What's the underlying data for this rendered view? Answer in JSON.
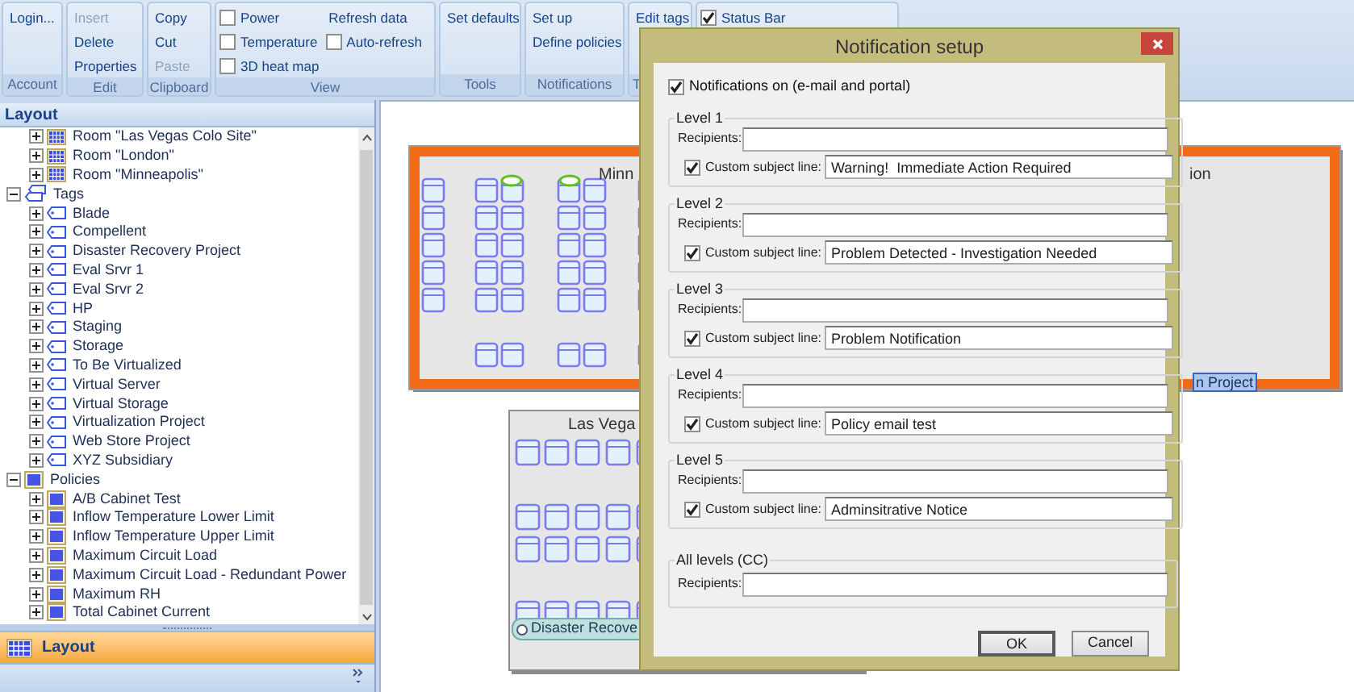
{
  "ribbon": {
    "groups": [
      {
        "label": "Account",
        "columns": [
          [
            {
              "kind": "button",
              "label": "Login...",
              "disabled": false
            }
          ]
        ]
      },
      {
        "label": "Edit",
        "columns": [
          [
            {
              "kind": "button",
              "label": "Insert",
              "disabled": true
            },
            {
              "kind": "button",
              "label": "Delete",
              "disabled": false
            },
            {
              "kind": "button",
              "label": "Properties",
              "disabled": false
            }
          ]
        ]
      },
      {
        "label": "Clipboard",
        "columns": [
          [
            {
              "kind": "button",
              "label": "Copy",
              "disabled": false
            },
            {
              "kind": "button",
              "label": "Cut",
              "disabled": false
            },
            {
              "kind": "button",
              "label": "Paste",
              "disabled": true
            }
          ]
        ]
      },
      {
        "label": "View",
        "columns": [
          [
            {
              "kind": "checkbox",
              "label": "Power",
              "checked": false
            },
            {
              "kind": "checkbox",
              "label": "Temperature",
              "checked": false
            },
            {
              "kind": "checkbox",
              "label": "3D heat map",
              "checked": false
            }
          ],
          [
            {
              "kind": "button",
              "label": "Refresh data",
              "disabled": false
            },
            {
              "kind": "checkbox",
              "label": "Auto-refresh",
              "checked": false
            }
          ]
        ]
      },
      {
        "label": "Tools",
        "columns": [
          [
            {
              "kind": "button",
              "label": "Set defaults",
              "disabled": false
            }
          ]
        ]
      },
      {
        "label": "Notifications",
        "columns": [
          [
            {
              "kind": "button",
              "label": "Set up",
              "disabled": false
            },
            {
              "kind": "button",
              "label": "Define policies",
              "disabled": false
            }
          ]
        ]
      },
      {
        "label": "T",
        "columns": [
          [
            {
              "kind": "button",
              "label": "Edit tags",
              "disabled": false
            }
          ]
        ]
      },
      {
        "columns": [
          [
            {
              "kind": "checkbox",
              "label": "Status Bar",
              "checked": true
            }
          ]
        ]
      }
    ]
  },
  "sidebar": {
    "title": "Layout",
    "tree": {
      "scrolled_children": [
        {
          "kind": "room",
          "label": "Room \"Las Vegas Colo Site\"",
          "expanded": false
        },
        {
          "kind": "room",
          "label": "Room \"London\"",
          "expanded": false
        },
        {
          "kind": "room",
          "label": "Room \"Minneapolis\"",
          "expanded": false
        }
      ],
      "items": [
        {
          "kind": "tags",
          "label": "Tags",
          "expanded": true,
          "children": [
            {
              "kind": "tag",
              "label": "Blade",
              "expanded": false
            },
            {
              "kind": "tag",
              "label": "Compellent",
              "expanded": false
            },
            {
              "kind": "tag",
              "label": "Disaster Recovery Project",
              "expanded": false
            },
            {
              "kind": "tag",
              "label": "Eval Srvr 1",
              "expanded": false
            },
            {
              "kind": "tag",
              "label": "Eval Srvr 2",
              "expanded": false
            },
            {
              "kind": "tag",
              "label": "HP",
              "expanded": false
            },
            {
              "kind": "tag",
              "label": "Staging",
              "expanded": false
            },
            {
              "kind": "tag",
              "label": "Storage",
              "expanded": false
            },
            {
              "kind": "tag",
              "label": "To Be Virtualized",
              "expanded": false
            },
            {
              "kind": "tag",
              "label": "Virtual Server",
              "expanded": false
            },
            {
              "kind": "tag",
              "label": "Virtual Storage",
              "expanded": false
            },
            {
              "kind": "tag",
              "label": "Virtualization Project",
              "expanded": false
            },
            {
              "kind": "tag",
              "label": "Web Store Project",
              "expanded": false
            },
            {
              "kind": "tag",
              "label": "XYZ Subsidiary",
              "expanded": false
            }
          ]
        },
        {
          "kind": "policies",
          "label": "Policies",
          "expanded": true,
          "children": [
            {
              "kind": "policy",
              "label": "A/B Cabinet Test",
              "expanded": false
            },
            {
              "kind": "policy",
              "label": "Inflow Temperature Lower Limit",
              "expanded": false
            },
            {
              "kind": "policy",
              "label": "Inflow Temperature Upper Limit",
              "expanded": false
            },
            {
              "kind": "policy",
              "label": "Maximum Circuit Load",
              "expanded": false
            },
            {
              "kind": "policy",
              "label": "Maximum Circuit Load - Redundant Power",
              "expanded": false
            },
            {
              "kind": "policy",
              "label": "Maximum RH",
              "expanded": false
            },
            {
              "kind": "policy",
              "label": "Total Cabinet Current",
              "expanded": false
            }
          ]
        }
      ]
    },
    "nav_buttons": [
      {
        "label": "Layout",
        "selected": true
      }
    ]
  },
  "canvas": {
    "rooms": [
      {
        "kind": "minneapolis",
        "title_fragments": [
          "Minn",
          "ion"
        ],
        "selected": true,
        "tag_label": "n Project"
      },
      {
        "kind": "las-vegas",
        "title_fragments": [
          "Las Vega"
        ],
        "selected": false,
        "tag_label": "Disaster Recove"
      }
    ]
  },
  "dialog": {
    "title": "Notification setup",
    "notifications_on": {
      "label": "Notifications on (e-mail and portal)",
      "checked": true
    },
    "levels": [
      {
        "title": "Level 1",
        "recipients_label": "Recipients:",
        "custom_subject": {
          "label": "Custom subject line:",
          "checked": true
        },
        "subject": "Warning!  Immediate Action Required"
      },
      {
        "title": "Level 2",
        "recipients_label": "Recipients:",
        "custom_subject": {
          "label": "Custom subject line:",
          "checked": true
        },
        "subject": "Problem Detected - Investigation Needed"
      },
      {
        "title": "Level 3",
        "recipients_label": "Recipients:",
        "custom_subject": {
          "label": "Custom subject line:",
          "checked": true
        },
        "subject": "Problem Notification"
      },
      {
        "title": "Level 4",
        "recipients_label": "Recipients:",
        "custom_subject": {
          "label": "Custom subject line:",
          "checked": true
        },
        "subject": "Policy email test"
      },
      {
        "title": "Level 5",
        "recipients_label": "Recipients:",
        "custom_subject": {
          "label": "Custom subject line:",
          "checked": true
        },
        "subject": "Adminsitrative Notice"
      }
    ],
    "cc": {
      "title": "All levels (CC)",
      "recipients_label": "Recipients:"
    },
    "buttons": [
      "OK",
      "Cancel"
    ]
  }
}
